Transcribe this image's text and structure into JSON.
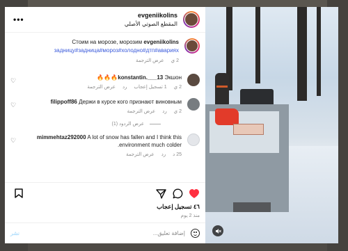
{
  "post": {
    "username": "evgeniikolins",
    "audio": "المقطع الصوتي الأصلي"
  },
  "caption": {
    "text": "Стоим на морозе, морозим",
    "username": "evgeniikolins",
    "tags": "задницу#задница#мороз#холодно#дтп#авариях",
    "age": "2 ي",
    "translate": "عرض الترجمة"
  },
  "comments": [
    {
      "username": "konstantin.___13",
      "text": "Экшон🔥🔥🔥",
      "age": "2 ي",
      "likes": "1 تسجيل إعجاب",
      "reply": "رد",
      "translate": "عرض الترجمة",
      "avatar_color": "#5a4a40"
    },
    {
      "username": "filippoff86",
      "text": "Держи в курсе кого признают виновным",
      "age": "2 ي",
      "reply": "رد",
      "translate": "عرض الترجمة",
      "avatar_color": "#777c80",
      "replies_label": "عرض الردود (1)"
    },
    {
      "username": "mimmehtaz292000",
      "text": "A lot of snow has fallen and I think this environment much colder.",
      "age": "25 د",
      "reply": "رد",
      "translate": "عرض الترجمة",
      "avatar_color": "#e4e6ea"
    }
  ],
  "stats": {
    "likes": "٤٦ تسجيل إعجاب",
    "date": "منذ 2 يوم"
  },
  "composer": {
    "placeholder": "إضافة تعليق...",
    "post_label": "نشر"
  },
  "icons": {
    "more": "more-icon",
    "bookmark": "bookmark-icon",
    "share": "share-icon",
    "comment": "comment-icon",
    "like": "heart-icon",
    "mute": "mute-icon",
    "emoji": "emoji-icon"
  },
  "colors": {
    "like_active": "#ff3040",
    "hashtag": "#3b5bdb",
    "post_button": "#b2dffc"
  }
}
